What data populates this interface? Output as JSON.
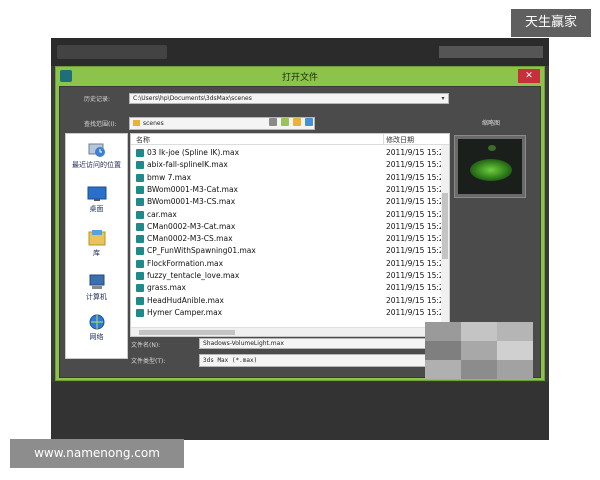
{
  "watermarks": {
    "top_right": "天生赢家",
    "bottom_left": "www.namenong.com"
  },
  "dialog": {
    "title": "打开文件",
    "close_glyph": "✕",
    "history_label": "历史记录:",
    "history_value": "C:\\Users\\hp\\Documents\\3dsMax\\scenes",
    "lookin_label": "查找范围(I):",
    "lookin_value": "scenes",
    "preview_label": "缩略图",
    "filename_label": "文件名(N):",
    "filename_value": "Shadows-VolumeLight.max",
    "filetype_label": "文件类型(T):",
    "filetype_value": "3ds Max (*.max)"
  },
  "places": [
    {
      "label": "最近访问的位置",
      "icon": "recent-places-icon"
    },
    {
      "label": "桌面",
      "icon": "desktop-icon"
    },
    {
      "label": "库",
      "icon": "library-icon"
    },
    {
      "label": "计算机",
      "icon": "computer-icon"
    },
    {
      "label": "网络",
      "icon": "network-icon"
    }
  ],
  "columns": {
    "name": "名称",
    "date": "修改日期"
  },
  "files": [
    {
      "name": "03 Ik-joe (Spline IK).max",
      "date": "2011/9/15 15:2"
    },
    {
      "name": "abix-fall-splineIK.max",
      "date": "2011/9/15 15:2"
    },
    {
      "name": "bmw 7.max",
      "date": "2011/9/15 15:2"
    },
    {
      "name": "BWom0001-M3-Cat.max",
      "date": "2011/9/15 15:2"
    },
    {
      "name": "BWom0001-M3-CS.max",
      "date": "2011/9/15 15:2"
    },
    {
      "name": "car.max",
      "date": "2011/9/15 15:2"
    },
    {
      "name": "CMan0002-M3-Cat.max",
      "date": "2011/9/15 15:2"
    },
    {
      "name": "CMan0002-M3-CS.max",
      "date": "2011/9/15 15:2"
    },
    {
      "name": "CP_FunWithSpawning01.max",
      "date": "2011/9/15 15:2"
    },
    {
      "name": "FlockFormation.max",
      "date": "2011/9/15 15:2"
    },
    {
      "name": "fuzzy_tentacle_love.max",
      "date": "2011/9/15 15:2"
    },
    {
      "name": "grass.max",
      "date": "2011/9/15 15:2"
    },
    {
      "name": "HeadHudAnible.max",
      "date": "2011/9/15 15:2"
    },
    {
      "name": "Hymer Camper.max",
      "date": "2011/9/15 15:2"
    }
  ]
}
